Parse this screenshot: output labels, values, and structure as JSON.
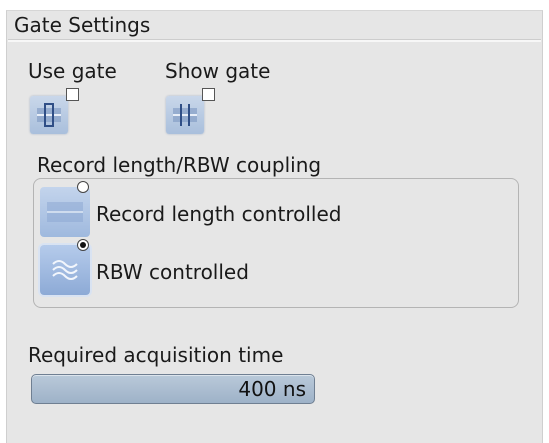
{
  "panel": {
    "title": "Gate Settings"
  },
  "gate": {
    "use_gate_label": "Use gate",
    "use_gate_checked": false,
    "show_gate_label": "Show gate",
    "show_gate_checked": false
  },
  "coupling": {
    "label": "Record length/RBW coupling",
    "options": [
      {
        "label": "Record length controlled",
        "selected": false,
        "icon": "record-length-icon"
      },
      {
        "label": "RBW controlled",
        "selected": true,
        "icon": "rbw-wave-icon"
      }
    ]
  },
  "acquisition": {
    "label": "Required acquisition time",
    "value": "400 ns"
  },
  "colors": {
    "panel_bg": "#e6e6e6",
    "icon_tile": "#a9bfdc",
    "field_bg": "#9eb2c8"
  }
}
